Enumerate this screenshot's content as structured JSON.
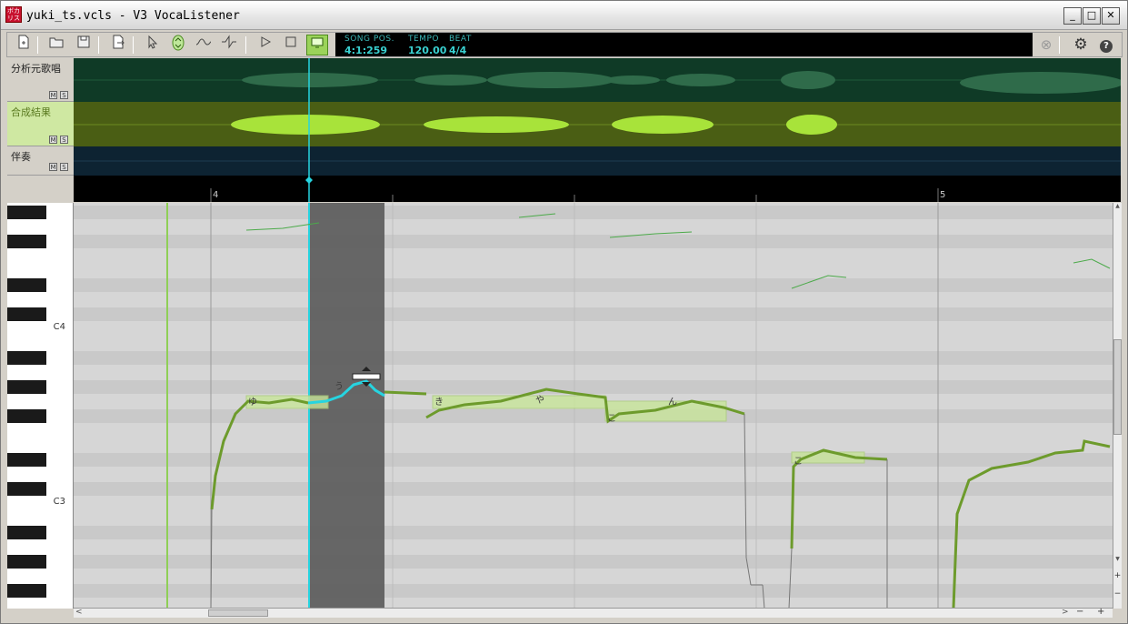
{
  "window": {
    "title": "yuki_ts.vcls - V3 VocaListener",
    "icon_text": "ボカリス",
    "minimize": "_",
    "maximize": "□",
    "close": "✕"
  },
  "toolbar": {
    "icons": [
      "new-file-icon",
      "open-folder-icon",
      "save-icon",
      "export-icon",
      "pointer-icon",
      "pitch-adjust-icon",
      "pitch-curve-icon",
      "dynamics-icon",
      "play-icon",
      "stop-icon",
      "monitor-icon"
    ],
    "song_pos_label": "SONG POS.",
    "song_pos_value": "4:1:259",
    "tempo_label": "TEMPO",
    "tempo_value": "120.00",
    "beat_label": "BEAT",
    "beat_value": "4/4",
    "cancel_glyph": "⊗",
    "settings_glyph": "⚙",
    "help_glyph": "?"
  },
  "tracks": [
    {
      "label": "分析元歌唱",
      "mute": "M",
      "solo": "S"
    },
    {
      "label": "合成結果",
      "mute": "M",
      "solo": "S"
    },
    {
      "label": "伴奏",
      "mute": "M",
      "solo": "S"
    }
  ],
  "ruler": {
    "measures": [
      "4",
      "5"
    ]
  },
  "piano": {
    "labels": [
      "C4",
      "C3"
    ]
  },
  "lyrics": [
    "ゆ",
    "う",
    "き",
    "や",
    "こ",
    "ん",
    "こ"
  ],
  "scroll": {
    "up": "▲",
    "down": "▼",
    "left": "<",
    "right": ">",
    "zoom_in": "+",
    "zoom_out": "−"
  },
  "colors": {
    "playhead": "#26d4e0",
    "pitch_line": "#6d9b2c",
    "note_fill": "#c8e59a",
    "wave_source": "#2f6b4a",
    "wave_synth": "#a8e33a"
  }
}
